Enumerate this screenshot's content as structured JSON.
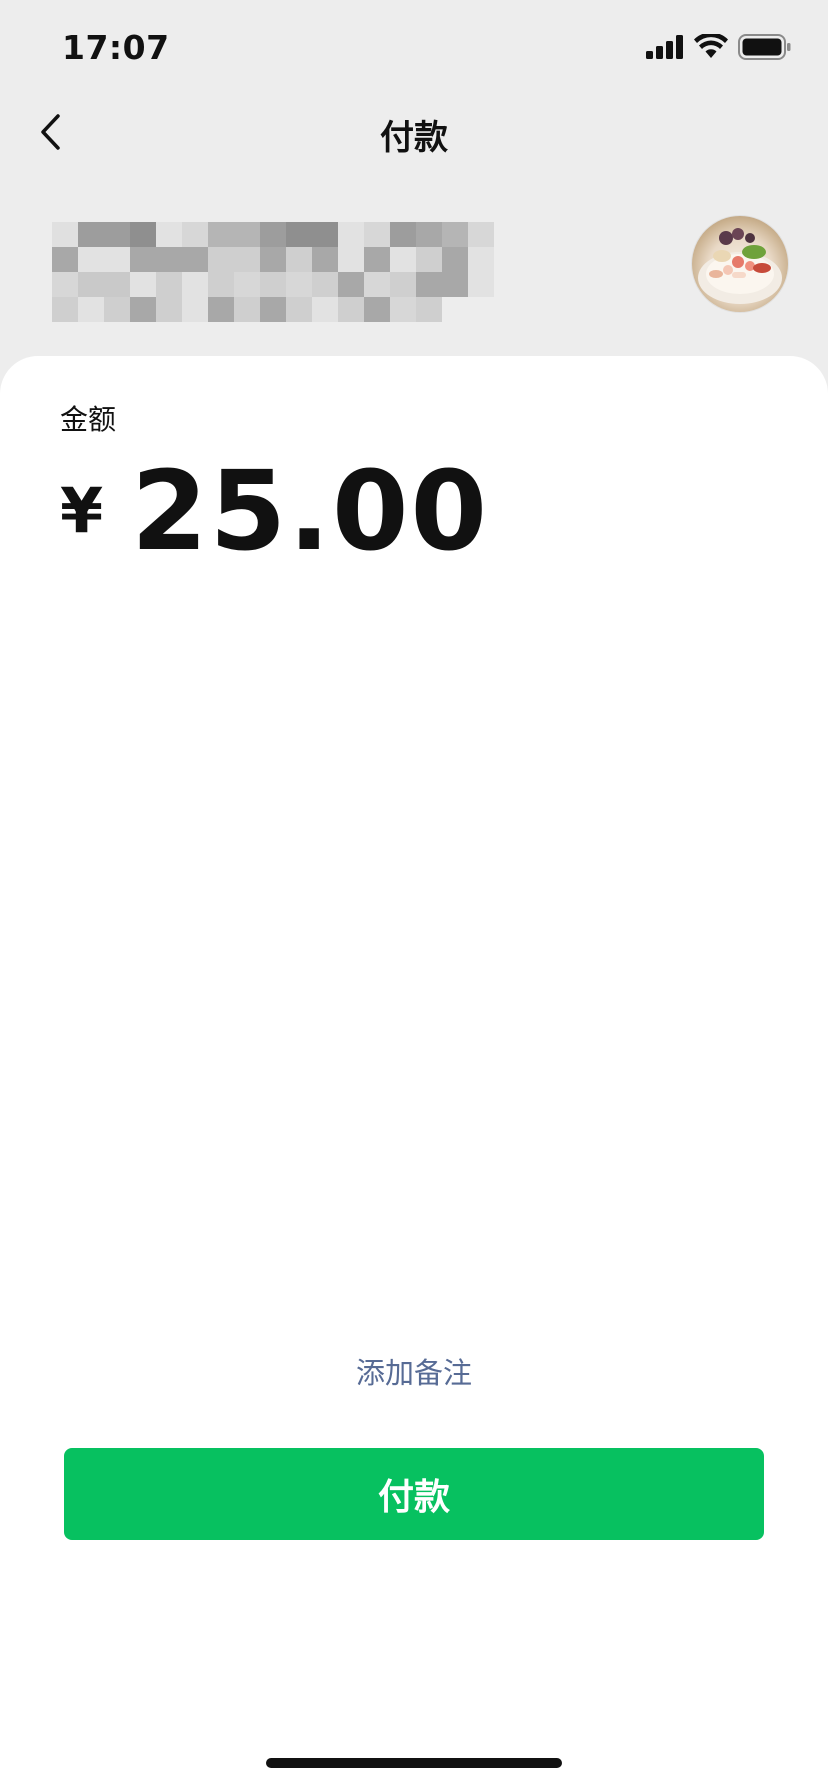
{
  "status_bar": {
    "time": "17:07",
    "icons": [
      "cellular-signal-icon",
      "wifi-icon",
      "battery-icon"
    ]
  },
  "nav": {
    "title": "付款",
    "back_icon": "chevron-left-icon"
  },
  "payee": {
    "name": "",
    "name_redacted": true,
    "avatar": "food-photo-avatar"
  },
  "amount": {
    "label": "金额",
    "currency": "¥",
    "value": "25.00"
  },
  "add_note": "添加备注",
  "pay_button": "付款",
  "colors": {
    "background": "#ededed",
    "card": "#ffffff",
    "primary_green": "#07c160",
    "link_blue": "#576b95",
    "text": "#111111"
  }
}
